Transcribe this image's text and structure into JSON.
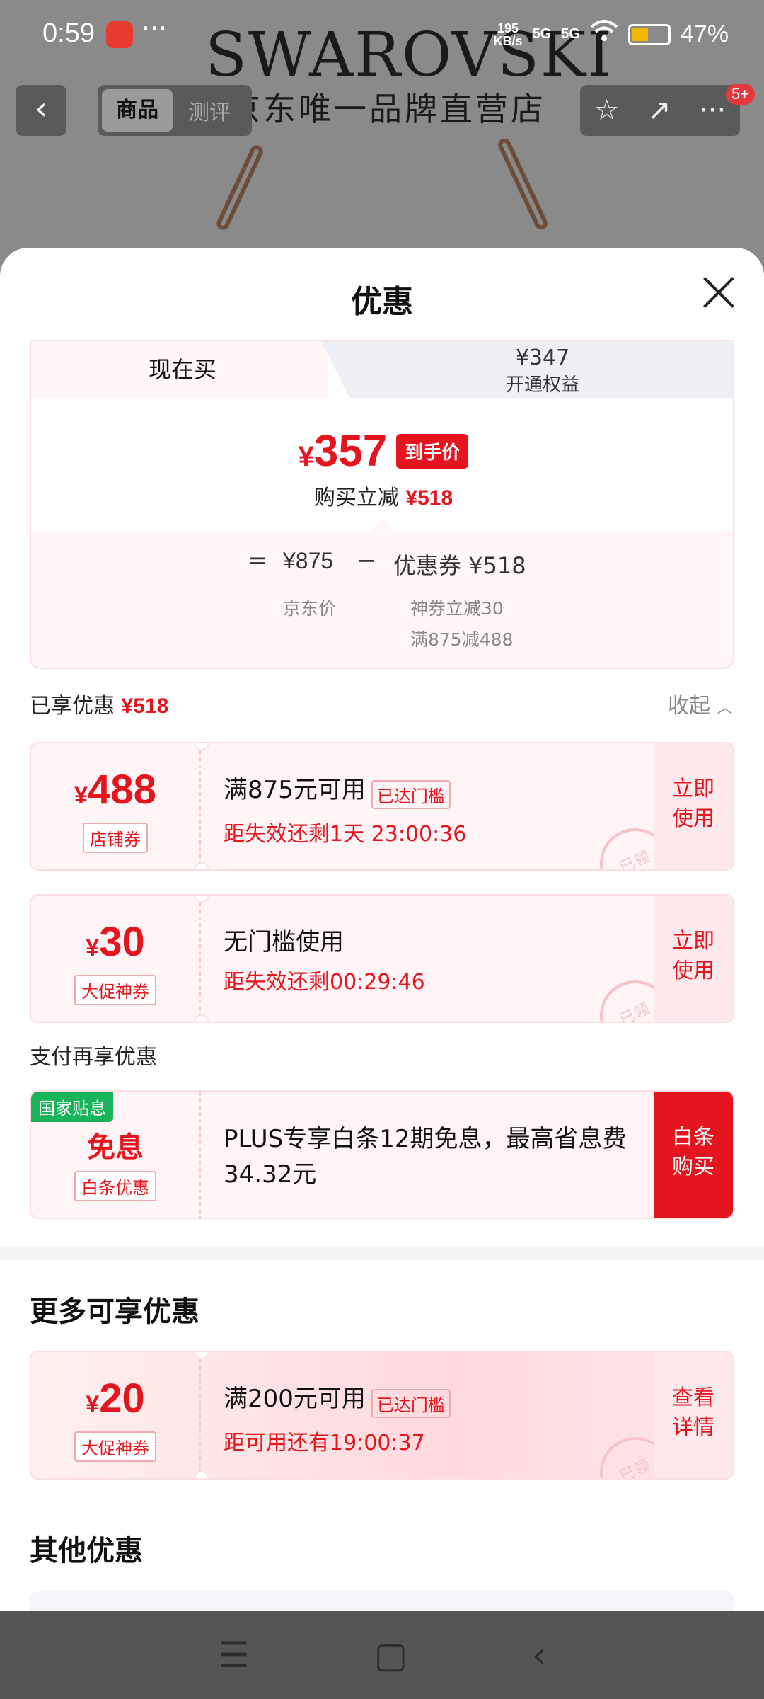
{
  "status_bar": {
    "time": "0:59",
    "menu_dots": "···",
    "net_speed_value": "195",
    "net_speed_unit": "KB/s",
    "signal_1": "5G",
    "signal_2": "5G",
    "battery_pct": "47%",
    "battery_level": 0.47
  },
  "background": {
    "brand_logo": "SWAROVSKI",
    "brand_sub": "京东唯一品牌直营店",
    "nav": {
      "back_icon": "chevron-left-icon",
      "tab_active": "商品",
      "tab_inactive": "测评",
      "badge": "5+"
    }
  },
  "sheet": {
    "title": "优惠",
    "price_tabs": {
      "now_label": "现在买",
      "plus_price": "¥347",
      "plus_label": "开通权益"
    },
    "price": {
      "yen": "¥",
      "final": "357",
      "tag": "到手价",
      "instant_label": "购买立减",
      "instant_amount": "¥518"
    },
    "formula": {
      "equals": "=",
      "jd_price": "¥875",
      "minus": "−",
      "coupon": "优惠券 ¥518",
      "jd_label": "京东价",
      "coupon_detail_1": "神券立减30",
      "coupon_detail_2": "满875减488"
    },
    "enjoyed": {
      "label": "已享优惠",
      "amount": "¥518",
      "collapse": "收起"
    },
    "coupons": [
      {
        "yen": "¥",
        "amount": "488",
        "type": "店铺券",
        "condition": "满875元可用",
        "badge": "已达门槛",
        "timer": "距失效还剩1天 23:00:36",
        "action": "立即\n使用",
        "stamp": "已领"
      },
      {
        "yen": "¥",
        "amount": "30",
        "type": "大促神券",
        "condition": "无门槛使用",
        "timer": "距失效还剩00:29:46",
        "action": "立即\n使用",
        "stamp": "已领"
      }
    ],
    "pay": {
      "title": "支付再享优惠",
      "gov_tag": "国家贴息",
      "free": "免息",
      "type": "白条优惠",
      "desc": "PLUS专享白条12期免息，最高省息费34.32元",
      "action": "白条\n购买"
    },
    "more": {
      "title": "更多可享优惠",
      "coupon": {
        "yen": "¥",
        "amount": "20",
        "type": "大促神券",
        "condition": "满200元可用",
        "badge": "已达门槛",
        "timer": "距可用还有19:00:37",
        "action": "查看\n详情",
        "stamp": "已领"
      }
    },
    "other_title": "其他优惠"
  },
  "system_nav": {
    "menu_icon": "☰",
    "home_icon": "▢",
    "back_icon": "‹"
  },
  "colors": {
    "accent_red": "#e4151f",
    "gov_green": "#19b359",
    "light_pink": "#fff5f6"
  }
}
